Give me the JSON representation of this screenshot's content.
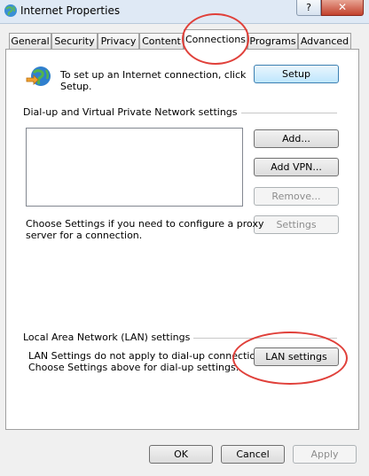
{
  "window": {
    "title": "Internet Properties",
    "help_label": "?",
    "close_label": "✕",
    "icon": "internet-globe-icon"
  },
  "tabs": [
    {
      "label": "General"
    },
    {
      "label": "Security"
    },
    {
      "label": "Privacy"
    },
    {
      "label": "Content"
    },
    {
      "label": "Connections",
      "active": true
    },
    {
      "label": "Programs"
    },
    {
      "label": "Advanced"
    }
  ],
  "setup": {
    "icon": "network-globe-icon",
    "text_line1": "To set up an Internet connection, click",
    "text_line2": "Setup.",
    "button": "Setup"
  },
  "dialup": {
    "group_label": "Dial-up and Virtual Private Network settings",
    "add_button": "Add...",
    "add_vpn_button": "Add VPN...",
    "remove_button": "Remove...",
    "settings_button": "Settings",
    "note_line1": "Choose Settings if you need to configure a proxy",
    "note_line2": "server for a connection."
  },
  "lan": {
    "group_label": "Local Area Network (LAN) settings",
    "text_line1": "LAN Settings do not apply to dial-up connections.",
    "text_line2": "Choose Settings above for dial-up settings.",
    "button": "LAN settings"
  },
  "footer": {
    "ok": "OK",
    "cancel": "Cancel",
    "apply": "Apply"
  },
  "colors": {
    "annotation_circle": "#e0403a"
  }
}
